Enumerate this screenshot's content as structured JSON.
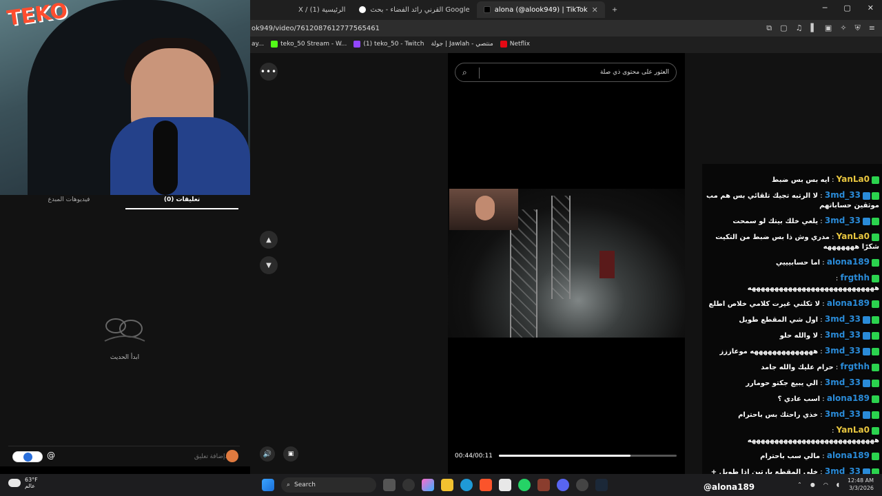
{
  "browser": {
    "tabs": [
      {
        "label": "X / الرئيسية (1)",
        "active": false
      },
      {
        "label": "القرني رائد الفضاء - بحث Google",
        "active": false
      },
      {
        "label": "alona (@alook949) | TikTok",
        "active": true
      }
    ],
    "new_tab": "+",
    "url": "ok949/video/7612087612777565461",
    "bookmarks": [
      {
        "label": "ay...",
        "color": "#999999"
      },
      {
        "label": "teko_50 Stream - W...",
        "color": "#53fc18"
      },
      {
        "label": "(1) teko_50 - Twitch",
        "color": "#9146ff"
      },
      {
        "label": "جولة | Jawlah - منتصي",
        "color": "#444444"
      },
      {
        "label": "Netflix",
        "color": "#e50914"
      }
    ],
    "window_controls": {
      "minimize": "─",
      "maximize": "▢",
      "close": "✕"
    }
  },
  "webcam": {
    "logo": "TEKO"
  },
  "comments_panel": {
    "tab_creator": "فيديوهات المبدع",
    "tab_comments": "تعليقات (0)",
    "empty_text": "ابدأ الحديث",
    "input_placeholder": "إضافة تعليق...",
    "at_symbol": "@"
  },
  "video": {
    "search_placeholder": "العثور على محتوى ذي صلة",
    "more_icon": "•••",
    "up_icon": "▲",
    "down_icon": "▼",
    "close_icon": "✕",
    "volume_icon": "🔊",
    "pip_icon": "▣",
    "time": "00:44/00:11",
    "progress_percent": 74
  },
  "chat": {
    "messages": [
      {
        "user": "YanLa0",
        "color": "#e8c63f",
        "badges": [
          "k"
        ],
        "text": "ايه بس بس ضبط"
      },
      {
        "user": "3md_33",
        "color": "#2a8bd8",
        "badges": [
          "k",
          "p"
        ],
        "text": "لا الرتبه تجيك تلقائي بس هم مب موثقين حساباتهم"
      },
      {
        "user": "3md_33",
        "color": "#2a8bd8",
        "badges": [
          "k",
          "p"
        ],
        "text": "يلعي خلك بيتك لو سمحت"
      },
      {
        "user": "YanLa0",
        "color": "#e8c63f",
        "badges": [
          "k"
        ],
        "text": "مدري وش ذا بس ضبط من التكيت شكرًا هههههههه"
      },
      {
        "user": "alona189",
        "color": "#2a8bd8",
        "badges": [
          "k"
        ],
        "text": "اما حسابيييي"
      },
      {
        "user": "frgthh",
        "color": "#2a8bd8",
        "badges": [
          "k"
        ],
        "text": "ههههههههههههههههههههههههههههه"
      },
      {
        "user": "alona189",
        "color": "#2a8bd8",
        "badges": [
          "k"
        ],
        "text": "لا تكلني غيرت كلامي خلاص اطلع"
      },
      {
        "user": "3md_33",
        "color": "#2a8bd8",
        "badges": [
          "k",
          "p"
        ],
        "text": "اول شي المقطع طويل"
      },
      {
        "user": "3md_33",
        "color": "#2a8bd8",
        "badges": [
          "k",
          "p"
        ],
        "text": "لا والله حلو"
      },
      {
        "user": "3md_33",
        "color": "#2a8bd8",
        "badges": [
          "k",
          "p"
        ],
        "text": "ههههههههههههههه موعاززز"
      },
      {
        "user": "frgthh",
        "color": "#2a8bd8",
        "badges": [
          "k"
        ],
        "text": "حرام عليك والله جامد"
      },
      {
        "user": "3md_33",
        "color": "#2a8bd8",
        "badges": [
          "k",
          "p"
        ],
        "text": "الي يبيع جكتو حومارر"
      },
      {
        "user": "alona189",
        "color": "#2a8bd8",
        "badges": [
          "k"
        ],
        "text": "اسب عادي ؟"
      },
      {
        "user": "3md_33",
        "color": "#2a8bd8",
        "badges": [
          "k",
          "p"
        ],
        "text": "خذي راحتك بس باحترام"
      },
      {
        "user": "YanLa0",
        "color": "#e8c63f",
        "badges": [
          "k"
        ],
        "text": "ههههههههههههههههههههههههههههه"
      },
      {
        "user": "alona189",
        "color": "#2a8bd8",
        "badges": [
          "k"
        ],
        "text": "مالي سب باحترام"
      },
      {
        "user": "3md_33",
        "color": "#2a8bd8",
        "badges": [
          "k",
          "p"
        ],
        "text": "خلي المقطع بارتين اذا طويل +"
      }
    ],
    "handle": "@alona189"
  },
  "taskbar": {
    "weather_temp": "63°F",
    "weather_label": "عالم",
    "search_label": "Search",
    "time": "12:48 AM",
    "date": "3/3/2026"
  }
}
